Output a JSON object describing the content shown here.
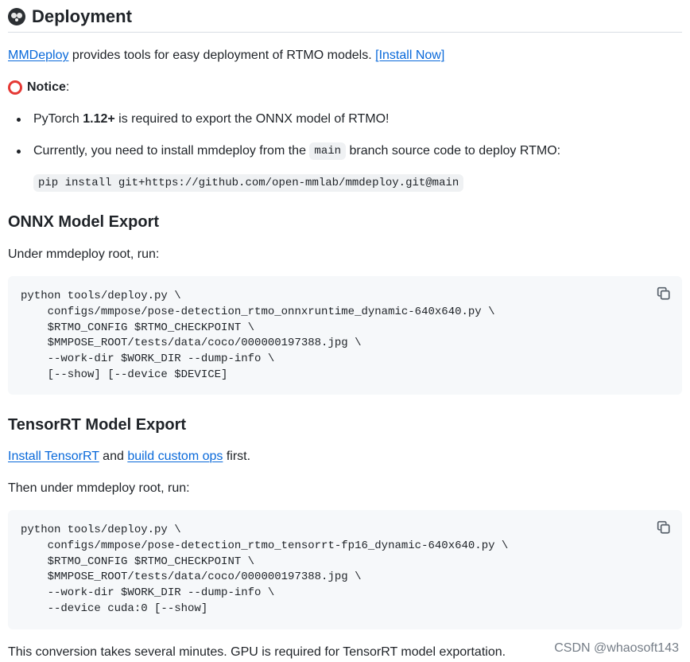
{
  "header": {
    "title": "Deployment",
    "emoji_icon": "panda-emoji-icon"
  },
  "intro": {
    "mmdeploy_link": "MMDeploy",
    "text": " provides tools for easy deployment of RTMO models. ",
    "install_link": "[Install Now]"
  },
  "notice": {
    "icon": "red-circle-icon",
    "title": "Notice",
    "colon": ":"
  },
  "requirements": {
    "items": [
      {
        "prefix": "PyTorch ",
        "bold": "1.12+",
        "suffix": " is required to export the ONNX model of RTMO!"
      },
      {
        "prefix": "Currently, you need to install mmdeploy from the ",
        "inline_code": "main",
        "suffix": " branch source code to deploy RTMO:"
      }
    ],
    "install_cmd": "pip install git+https://github.com/open-mmlab/mmdeploy.git@main"
  },
  "onnx": {
    "heading": "ONNX Model Export",
    "instruction": "Under mmdeploy root, run:",
    "code": "python tools/deploy.py \\\n    configs/mmpose/pose-detection_rtmo_onnxruntime_dynamic-640x640.py \\\n    $RTMO_CONFIG $RTMO_CHECKPOINT \\\n    $MMPOSE_ROOT/tests/data/coco/000000197388.jpg \\\n    --work-dir $WORK_DIR --dump-info \\\n    [--show] [--device $DEVICE]"
  },
  "tensorrt": {
    "heading": "TensorRT Model Export",
    "line1": {
      "install_link": "Install TensorRT",
      "and": " and ",
      "build_link": "build custom ops",
      "first": " first."
    },
    "instruction": "Then under mmdeploy root, run:",
    "code": "python tools/deploy.py \\\n    configs/mmpose/pose-detection_rtmo_tensorrt-fp16_dynamic-640x640.py \\\n    $RTMO_CONFIG $RTMO_CHECKPOINT \\\n    $MMPOSE_ROOT/tests/data/coco/000000197388.jpg \\\n    --work-dir $WORK_DIR --dump-info \\\n    --device cuda:0 [--show]"
  },
  "footer": {
    "note": "This conversion takes several minutes. GPU is required for TensorRT model exportation.",
    "watermark": "CSDN @whaosoft143"
  },
  "colors": {
    "link": "#0969da",
    "text": "#1f2328",
    "code_bg": "#f6f8fa",
    "inline_code_bg": "#eff1f3",
    "notice_red": "#e53935"
  }
}
